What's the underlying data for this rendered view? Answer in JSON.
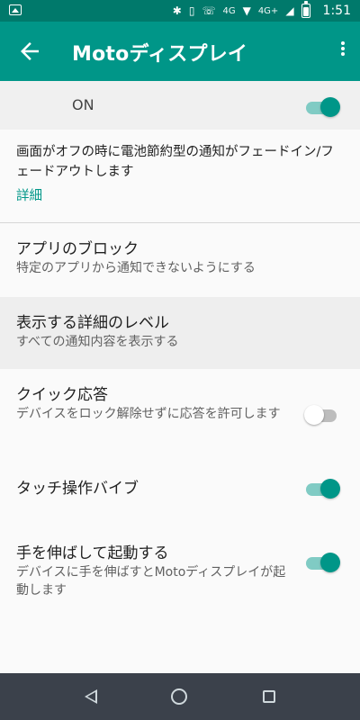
{
  "status_bar": {
    "time": "1:51",
    "network": "4G+",
    "lte": "4G",
    "icons": [
      "image-icon",
      "bluetooth-icon",
      "vibrate-icon",
      "call-wifi-icon",
      "wifi-icon",
      "signal-icon",
      "battery-icon"
    ]
  },
  "app_bar": {
    "title": "Motoディスプレイ",
    "back_icon": "arrow-back-icon",
    "overflow_icon": "more-vert-icon"
  },
  "master_toggle": {
    "label": "ON",
    "state": true
  },
  "description": {
    "text": "画面がオフの時に電池節約型の通知がフェードイン/フェードアウトします",
    "details_link": "詳細"
  },
  "settings": [
    {
      "title": "アプリのブロック",
      "subtitle": "特定のアプリから通知できないようにする"
    },
    {
      "title": "表示する詳細のレベル",
      "subtitle": "すべての通知内容を表示する"
    },
    {
      "title": "クイック応答",
      "subtitle": "デバイスをロック解除せずに応答を許可します",
      "toggle": false
    },
    {
      "title": "タッチ操作バイブ",
      "subtitle": "",
      "toggle": true
    },
    {
      "title": "手を伸ばして起動する",
      "subtitle": "デバイスに手を伸ばすとMotoディスプレイが起動します",
      "toggle": true
    }
  ],
  "navigation": {
    "back": "back-icon",
    "home": "home-icon",
    "recents": "recents-icon"
  },
  "colors": {
    "status_bar": "#00796b",
    "app_bar": "#009688",
    "accent": "#009688",
    "nav_bar": "#3b414b"
  }
}
